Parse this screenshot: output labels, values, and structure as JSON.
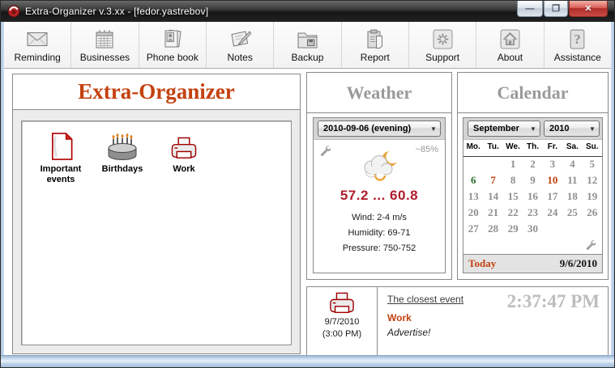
{
  "window": {
    "title": "Extra-Organizer v.3.xx - [fedor.yastrebov]",
    "minimize_glyph": "—",
    "maximize_glyph": "❐",
    "close_glyph": "✕"
  },
  "toolbar": {
    "items": [
      {
        "label": "Reminding",
        "icon": "envelope-icon"
      },
      {
        "label": "Businesses",
        "icon": "calendar-icon"
      },
      {
        "label": "Phone book",
        "icon": "phonebook-icon"
      },
      {
        "label": "Notes",
        "icon": "notes-icon"
      },
      {
        "label": "Backup",
        "icon": "backup-folder-icon"
      },
      {
        "label": "Report",
        "icon": "report-icon"
      },
      {
        "label": "Support",
        "icon": "support-icon"
      },
      {
        "label": "About",
        "icon": "home-icon"
      },
      {
        "label": "Assistance",
        "icon": "question-icon"
      }
    ]
  },
  "left_panel": {
    "title": "Extra-Organizer",
    "shortcuts": [
      {
        "label": "Important events",
        "icon": "document-icon"
      },
      {
        "label": "Birthdays",
        "icon": "cake-icon"
      },
      {
        "label": "Work",
        "icon": "printer-icon"
      }
    ]
  },
  "weather": {
    "header": "Weather",
    "selected_period": "2010-09-06 (evening)",
    "chance": "~85%",
    "temperature": "57.2 ... 60.8",
    "wind": "Wind: 2-4 m/s",
    "humidity": "Humidity: 69-71",
    "pressure": "Pressure: 750-752"
  },
  "calendar": {
    "header": "Calendar",
    "month": "September",
    "year": "2010",
    "day_headers": [
      "Mo.",
      "Tu.",
      "We.",
      "Th.",
      "Fr.",
      "Sa.",
      "Su."
    ],
    "weeks": [
      [
        "",
        "",
        "1",
        "2",
        "3",
        "4",
        "5"
      ],
      [
        "6",
        "7",
        "8",
        "9",
        "10",
        "11",
        "12"
      ],
      [
        "13",
        "14",
        "15",
        "16",
        "17",
        "18",
        "19"
      ],
      [
        "20",
        "21",
        "22",
        "23",
        "24",
        "25",
        "26"
      ],
      [
        "27",
        "28",
        "29",
        "30",
        "",
        "",
        ""
      ]
    ],
    "today_day": "6",
    "event_days": [
      "7",
      "10"
    ],
    "today_label": "Today",
    "today_date": "9/6/2010"
  },
  "event_panel": {
    "date": "9/7/2010",
    "time": "(3:00 PM)",
    "heading": "The closest event",
    "name": "Work",
    "note": "Advertise!",
    "clock": "2:37:47 PM"
  },
  "colors": {
    "accent_orange": "#c4410f",
    "temperature_red": "#ad1d2d",
    "today_green": "#2e6b2e",
    "section_header_gray": "#9a9a9a"
  }
}
